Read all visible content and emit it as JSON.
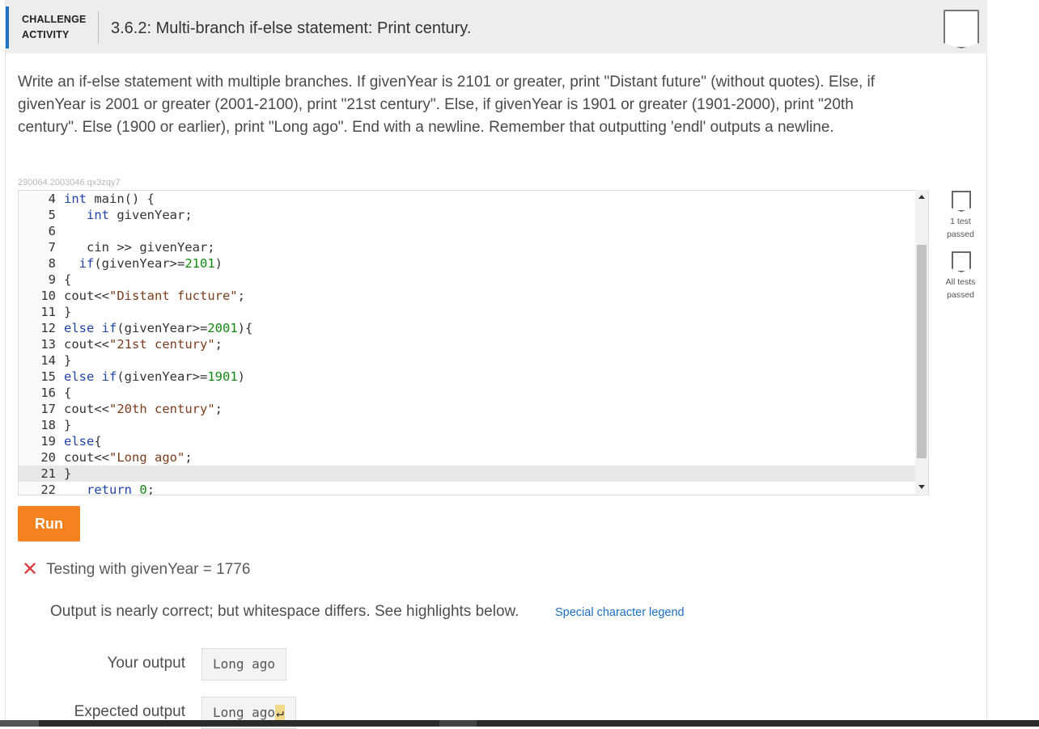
{
  "header": {
    "type_line1": "CHALLENGE",
    "type_line2": "ACTIVITY",
    "title": "3.6.2: Multi-branch if-else statement: Print century."
  },
  "instructions": "Write an if-else statement with multiple branches. If givenYear is 2101 or greater, print \"Distant future\" (without quotes). Else, if givenYear is 2001 or greater (2001-2100), print \"21st century\". Else, if givenYear is 1901 or greater (1901-2000), print \"20th century\". Else (1900 or earlier), print \"Long ago\". End with a newline. Remember that outputting 'endl' outputs a newline.",
  "code_id": "290064.2003046.qx3zqy7",
  "code_lines": [
    {
      "num": "4",
      "text": "int main() {"
    },
    {
      "num": "5",
      "text": "   int givenYear;"
    },
    {
      "num": "6",
      "text": ""
    },
    {
      "num": "7",
      "text": "   cin >> givenYear;"
    },
    {
      "num": "8",
      "text": "  if(givenYear>=2101)"
    },
    {
      "num": "9",
      "text": "{"
    },
    {
      "num": "10",
      "text": "cout<<\"Distant fucture\";"
    },
    {
      "num": "11",
      "text": "}"
    },
    {
      "num": "12",
      "text": "else if(givenYear>=2001){"
    },
    {
      "num": "13",
      "text": "cout<<\"21st century\";"
    },
    {
      "num": "14",
      "text": "}"
    },
    {
      "num": "15",
      "text": "else if(givenYear>=1901)"
    },
    {
      "num": "16",
      "text": "{"
    },
    {
      "num": "17",
      "text": "cout<<\"20th century\";"
    },
    {
      "num": "18",
      "text": "}"
    },
    {
      "num": "19",
      "text": "else{"
    },
    {
      "num": "20",
      "text": "cout<<\"Long ago\";"
    },
    {
      "num": "21",
      "text": "}"
    },
    {
      "num": "22",
      "text": "   return 0;"
    }
  ],
  "run_label": "Run",
  "result": {
    "icon": "x-icon",
    "text": "Testing with givenYear = 1776",
    "feedback": "Output is nearly correct; but whitespace differs. See highlights below.",
    "legend_link": "Special character legend",
    "your_output_label": "Your output",
    "your_output_value": "Long ago",
    "expected_output_label": "Expected output",
    "expected_output_value": "Long ago",
    "expected_newline_glyph": "↵"
  },
  "side": {
    "test1_label": "1 test passed",
    "test2_label": "All tests passed"
  }
}
